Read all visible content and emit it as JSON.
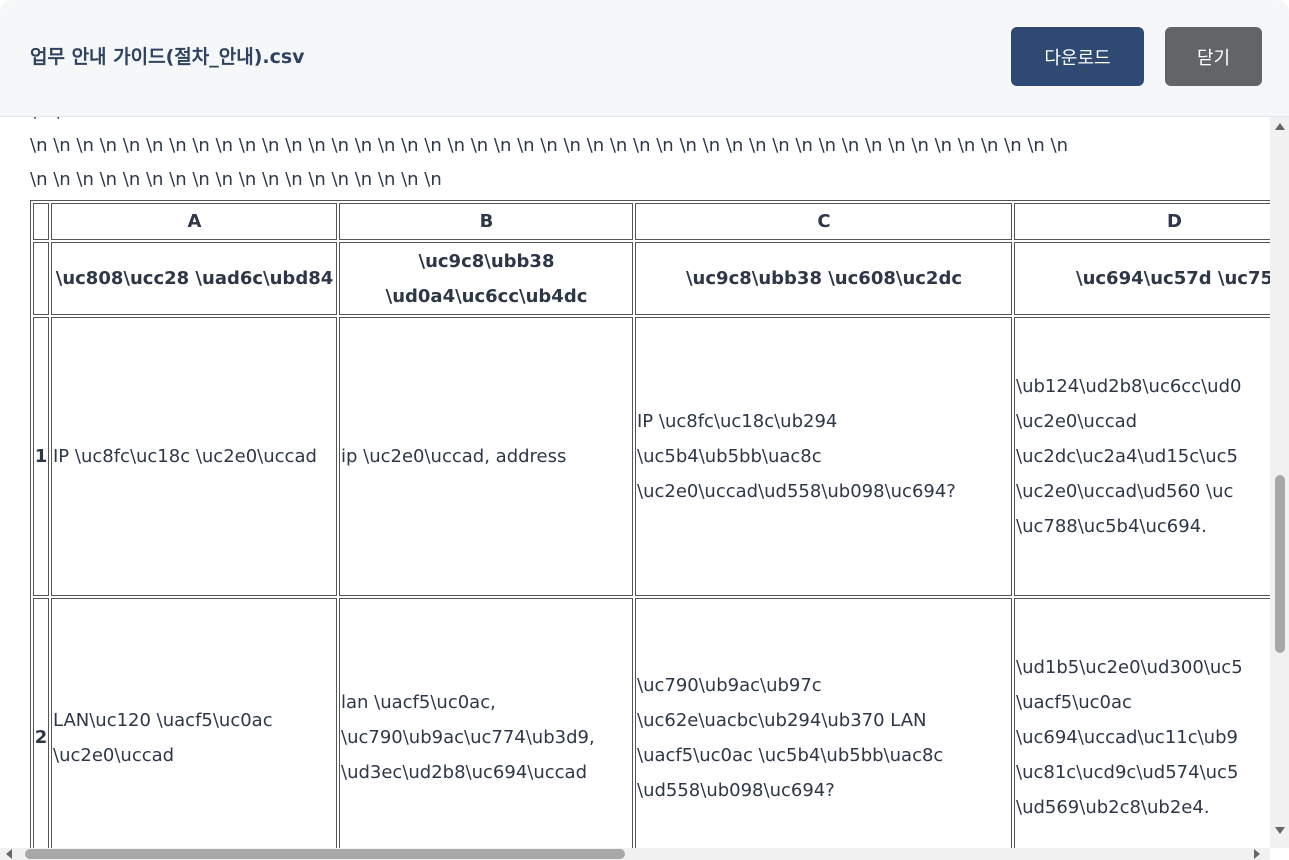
{
  "header": {
    "file_name": "업무 안내 가이드(절차_안내).csv",
    "download_label": "다운로드",
    "close_label": "닫기"
  },
  "preview": {
    "newline_lines": [
      "\\n \\n",
      "\\n \\n \\n \\n \\n \\n \\n \\n \\n \\n \\n \\n \\n \\n \\n \\n \\n \\n \\n \\n \\n \\n \\n \\n \\n \\n \\n \\n \\n \\n \\n \\n \\n \\n \\n \\n \\n \\n \\n \\n \\n \\n \\n \\n \\n",
      "\\n \\n \\n \\n \\n \\n \\n \\n \\n \\n \\n \\n \\n \\n \\n \\n \\n \\n"
    ],
    "table": {
      "column_letters": [
        "A",
        "B",
        "C",
        "D"
      ],
      "column_labels": [
        "\\uc808\\ucc28 \\uad6c\\ubd84",
        "\\uc9c8\\ubb38 \\ud0a4\\uc6cc\\ub4dc",
        "\\uc9c8\\ubb38 \\uc608\\uc2dc",
        "\\uc694\\uc57d \\uc75"
      ],
      "rows": [
        {
          "num": "1",
          "cells": [
            "IP \\uc8fc\\uc18c \\uc2e0\\uccad",
            "ip \\uc2e0\\uccad, address",
            "IP \\uc8fc\\uc18c\\ub294 \\uc5b4\\ub5bb\\uac8c \\uc2e0\\uccad\\ud558\\ub098\\uc694?",
            "\\ub124\\ud2b8\\uc6cc\\ud0 \\uc2e0\\uccad \\uc2dc\\uc2a4\\ud15c\\uc5 \\uc2e0\\uccad\\ud560 \\uc \\uc788\\uc5b4\\uc694."
          ]
        },
        {
          "num": "2",
          "cells": [
            "LAN\\uc120 \\uacf5\\uc0ac \\uc2e0\\uccad",
            "lan \\uacf5\\uc0ac, \\uc790\\ub9ac\\uc774\\ub3d9, \\ud3ec\\ud2b8\\uc694\\uccad",
            "\\uc790\\ub9ac\\ub97c \\uc62e\\uacbc\\ub294\\ub370 LAN \\uacf5\\uc0ac \\uc5b4\\ub5bb\\uac8c \\ud558\\ub098\\uc694?",
            "\\ud1b5\\uc2e0\\ud300\\uc5 \\uacf5\\uc0ac \\uc694\\uccad\\uc11c\\ub9 \\uc81c\\ucd9c\\ud574\\uc5 \\ud569\\ub2c8\\ub2e4."
          ]
        }
      ]
    }
  }
}
